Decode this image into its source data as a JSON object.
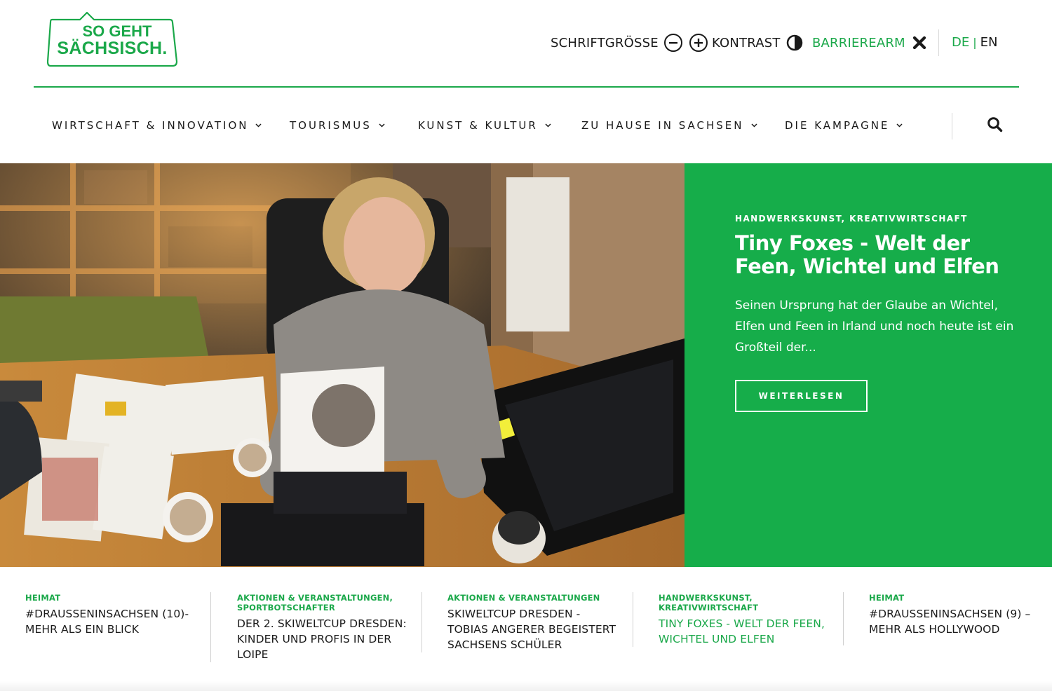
{
  "brand": {
    "logo_line1": "SO GEHT",
    "logo_line2": "SÄCHSISCH.",
    "accent_color": "#1ba84a"
  },
  "accessibility": {
    "font_size_label": "SCHRIFTGRÖSSE",
    "contrast_label": "KONTRAST",
    "low_barrier_label": "BARRIEREARM"
  },
  "language": {
    "de": "DE",
    "separator": "|",
    "en": "EN",
    "active": "DE"
  },
  "nav": {
    "items": [
      {
        "label": "WIRTSCHAFT & INNOVATION"
      },
      {
        "label": "TOURISMUS"
      },
      {
        "label": "KUNST & KULTUR"
      },
      {
        "label": "ZU HAUSE IN SACHSEN"
      },
      {
        "label": "DIE KAMPAGNE"
      }
    ],
    "search_icon": "search-icon"
  },
  "hero": {
    "category": "HANDWERKSKUNST, KREATIVWIRTSCHAFT",
    "title": "Tiny Foxes - Welt der Feen, Wichtel und Elfen",
    "text": "Seinen Ursprung hat der Glaube an Wichtel, Elfen und Feen in Irland und noch heute ist ein Großteil der...",
    "button_label": "WEITERLESEN",
    "panel_color": "#16ad4a"
  },
  "teasers": [
    {
      "category": "HEIMAT",
      "title": "#DRAUSSENINSACHSEN (10)- MEHR ALS EIN BLICK"
    },
    {
      "category": "AKTIONEN & VERANSTALTUNGEN, SPORTBOTSCHAFTER",
      "title": "DER 2. SKIWELTCUP DRESDEN: KINDER UND PROFIS IN DER LOIPE"
    },
    {
      "category": "AKTIONEN & VERANSTALTUNGEN",
      "title": "SKIWELTCUP DRESDEN - TOBIAS ANGERER BEGEISTERT SACHSENS SCHÜLER"
    },
    {
      "category": "HANDWERKSKUNST, KREATIVWIRTSCHAFT",
      "title": "TINY FOXES - WELT DER FEEN, WICHTEL UND ELFEN"
    },
    {
      "category": "HEIMAT",
      "title": "#DRAUSSENINSACHSEN (9) – MEHR ALS HOLLYWOOD"
    }
  ]
}
